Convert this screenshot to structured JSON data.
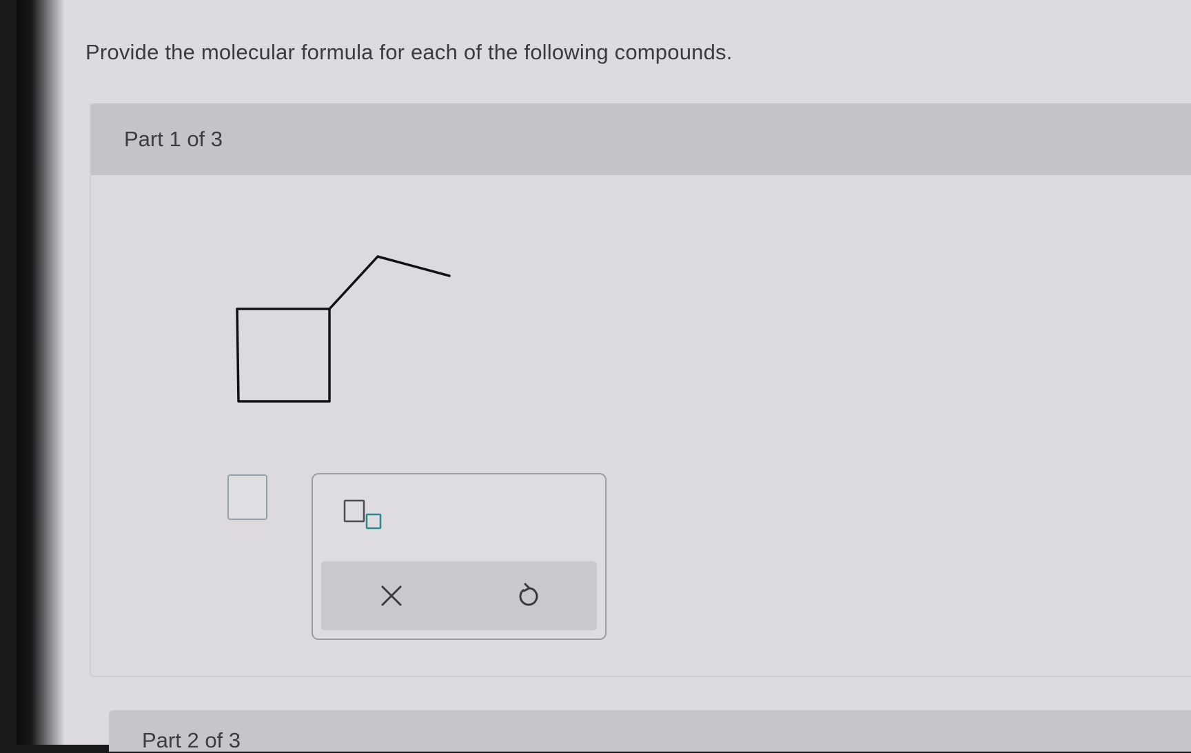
{
  "question": {
    "text": "Provide the molecular formula for each of the following compounds."
  },
  "parts": [
    {
      "title": "Part 1 of 3",
      "structure_icon": "ethylcyclobutane-skeletal-structure",
      "answer_input_icon": "empty-answer-box",
      "tools": {
        "subscript_icon": "subscript-template-icon",
        "clear_icon": "x-icon",
        "undo_icon": "undo-icon"
      }
    },
    {
      "title": "Part 2 of 3"
    }
  ],
  "colors": {
    "accent": "#2a8a8a",
    "panel_header": "#c4c3c9",
    "background": "#dddbe0"
  }
}
